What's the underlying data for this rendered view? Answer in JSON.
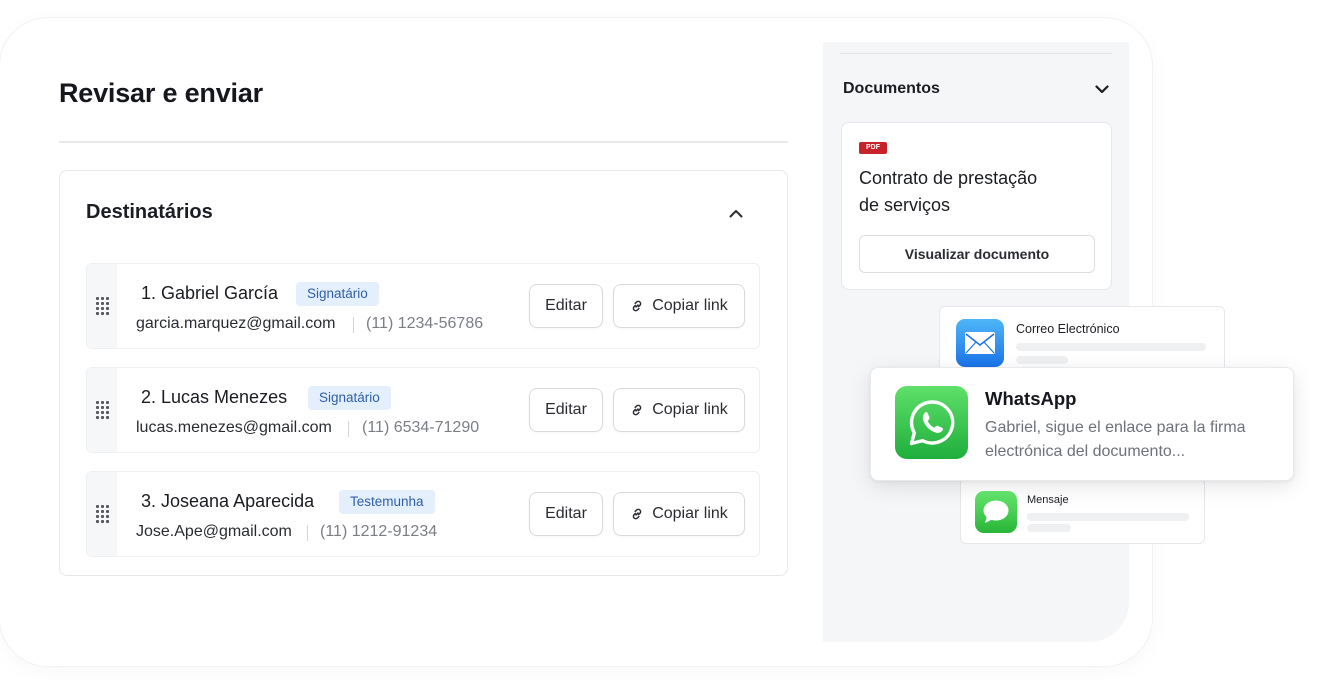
{
  "page": {
    "title": "Revisar e enviar"
  },
  "recipients": {
    "title": "Destinatários",
    "edit_label": "Editar",
    "copy_label": "Copiar link",
    "items": [
      {
        "name": "1. Gabriel García",
        "role": "Signatário",
        "email": "garcia.marquez@gmail.com",
        "phone": "(11) 1234-56786"
      },
      {
        "name": "2. Lucas Menezes",
        "role": "Signatário",
        "email": "lucas.menezes@gmail.com",
        "phone": "(11) 6534-71290"
      },
      {
        "name": "3. Joseana Aparecida",
        "role": "Testemunha",
        "email": "Jose.Ape@gmail.com",
        "phone": "(11) 1212-91234"
      }
    ]
  },
  "documents": {
    "title": "Documentos",
    "file_badge": "PDF",
    "doc_name_line1": "Contrato de prestação",
    "doc_name_line2": "de serviços",
    "view_button": "Visualizar documento"
  },
  "notifications": {
    "mail_label": "Correo Electrónico",
    "whatsapp_title": "WhatsApp",
    "whatsapp_message": "Gabriel, sigue el enlace para la firma electrónica del documento...",
    "message_label": "Mensaje"
  },
  "colors": {
    "badge_bg": "#e4effc",
    "badge_text": "#2f5fa8",
    "whatsapp_green": "#25c244",
    "pdf_red": "#c8222a"
  }
}
